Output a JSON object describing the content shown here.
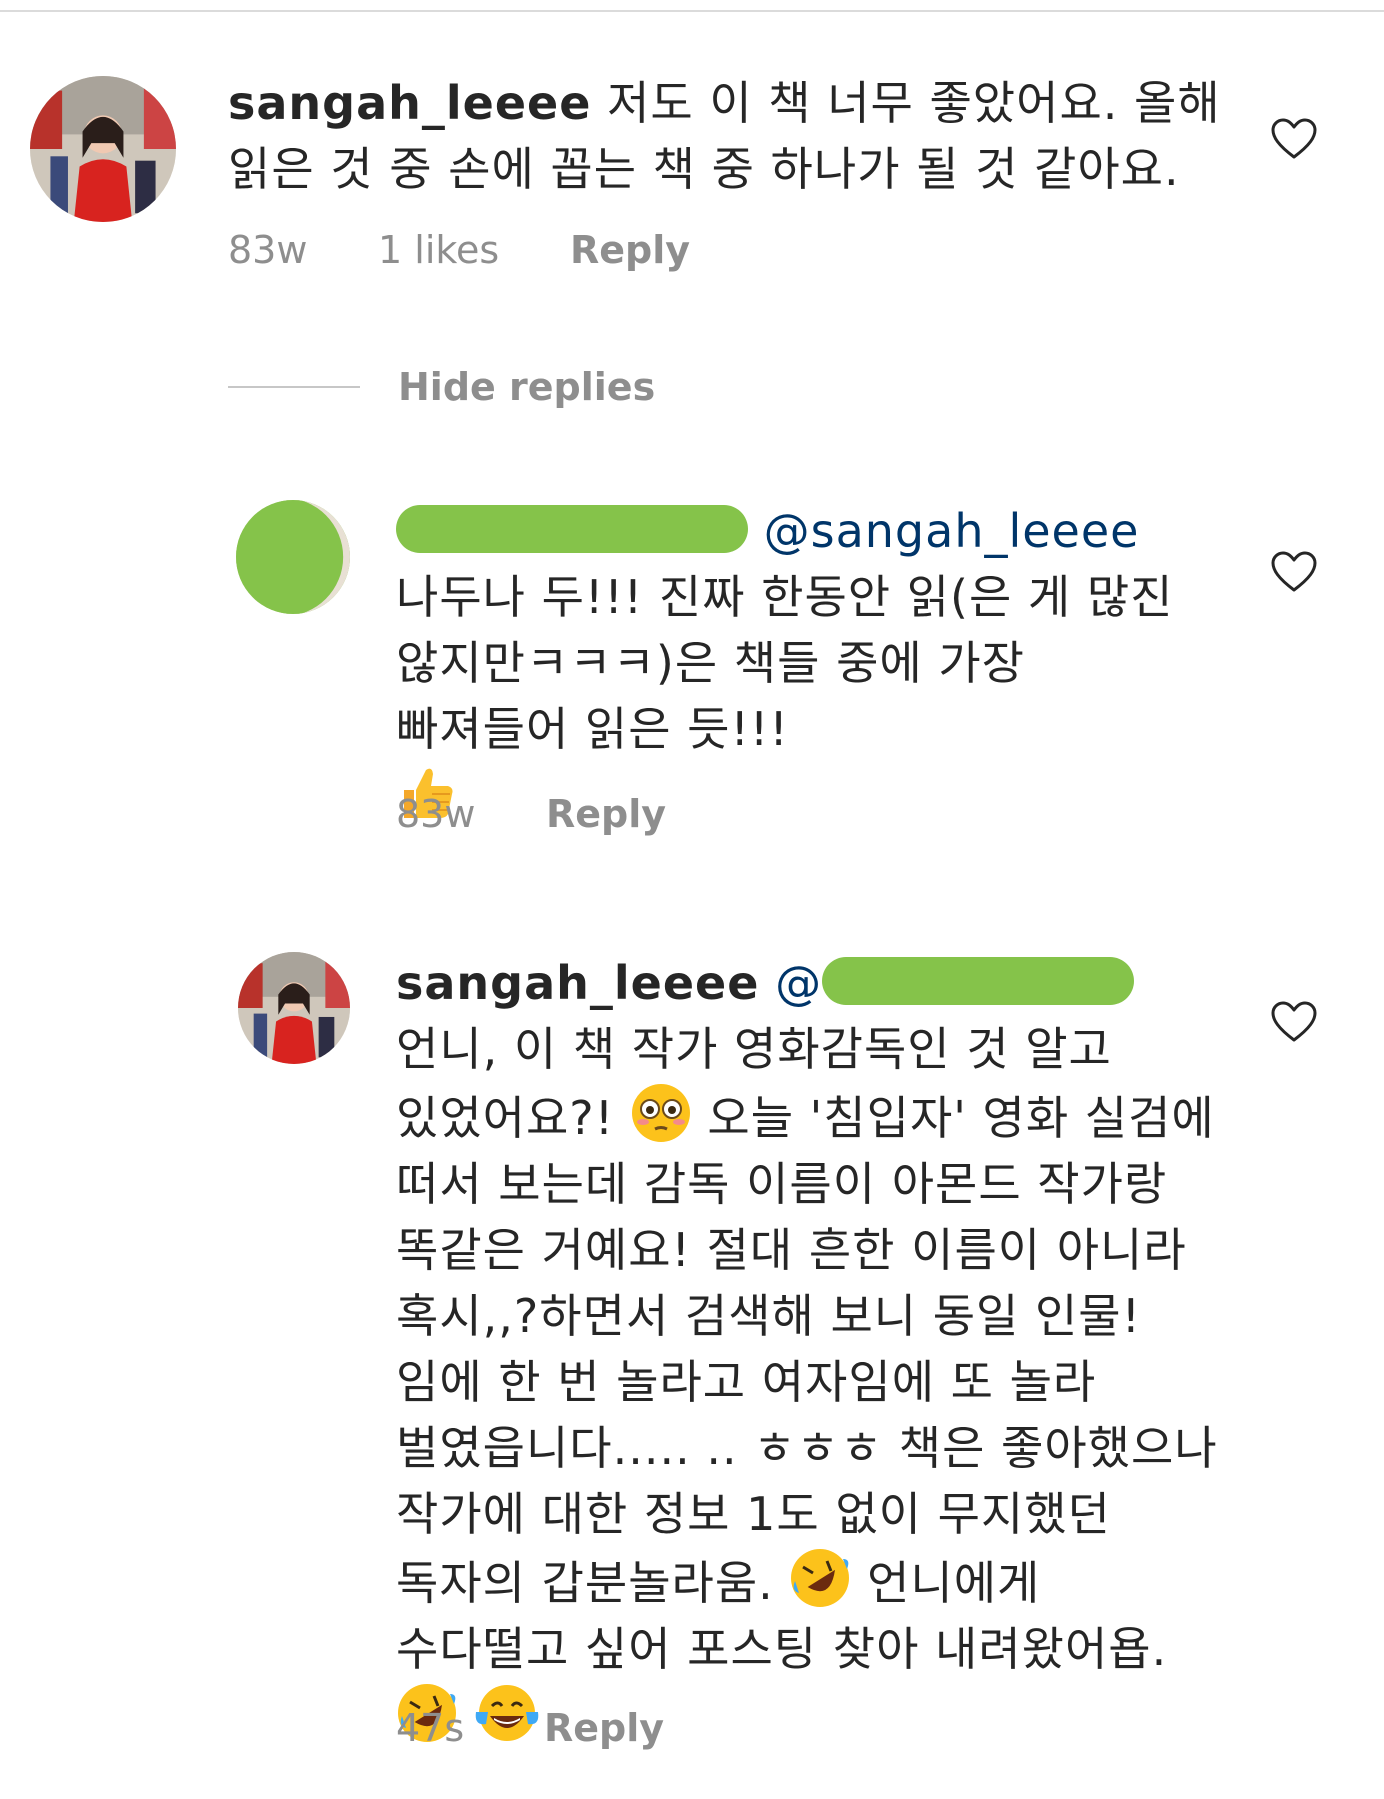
{
  "comments": [
    {
      "username": "sangah_leeee",
      "text": "저도 이 책 너무 좋았어요. 올해 읽은 것 중 손에 꼽는 책 중 하나가 될 것 같아요.",
      "time": "83w",
      "likes": "1 likes",
      "reply_label": "Reply"
    },
    {
      "mention": "@sangah_leeee",
      "text_line1": "나두나",
      "text_rest": "두!!! 진짜 한동안 읽(은 게 많진 않지만ㅋㅋㅋ)은 책들 중에 가장 빠져들어 읽은 듯!!!",
      "time": "83w",
      "reply_label": "Reply"
    },
    {
      "username": "sangah_leeee",
      "mention_prefix": "@",
      "text": "언니, 이 책 작가 영화감독인 것 알고 있었어요?!",
      "text2": "오늘 '침입자' 영화 실검에 떠서 보는데 감독 이름이 아몬드 작가랑 똑같은 거예요! 절대 흔한 이름이 아니라 혹시,,?하면서 검색해 보니 동일 인물!임에 한 번 놀라고 여자임에 또 놀라 벌였읍니다..... .. ㅎㅎㅎ 책은 좋아했으나 작가에 대한 정보 1도 없이 무지했던 독자의 갑분놀라움.",
      "text3": "언니에게 수다떨고 싶어 포스팅 찾아 내려왔어욥.",
      "time": "47s",
      "reply_label": "Reply"
    }
  ],
  "hide_replies_label": "Hide replies",
  "icons": {
    "heart": "heart-outline-icon",
    "thumbs_up": "thumbs-up-emoji",
    "flushed": "flushed-face-emoji",
    "rofl": "rolling-on-floor-laughing-emoji",
    "joy": "face-with-tears-of-joy-emoji"
  },
  "colors": {
    "text": "#262626",
    "meta": "#8e8e8e",
    "mention": "#003569",
    "redaction": "#85c34a"
  }
}
